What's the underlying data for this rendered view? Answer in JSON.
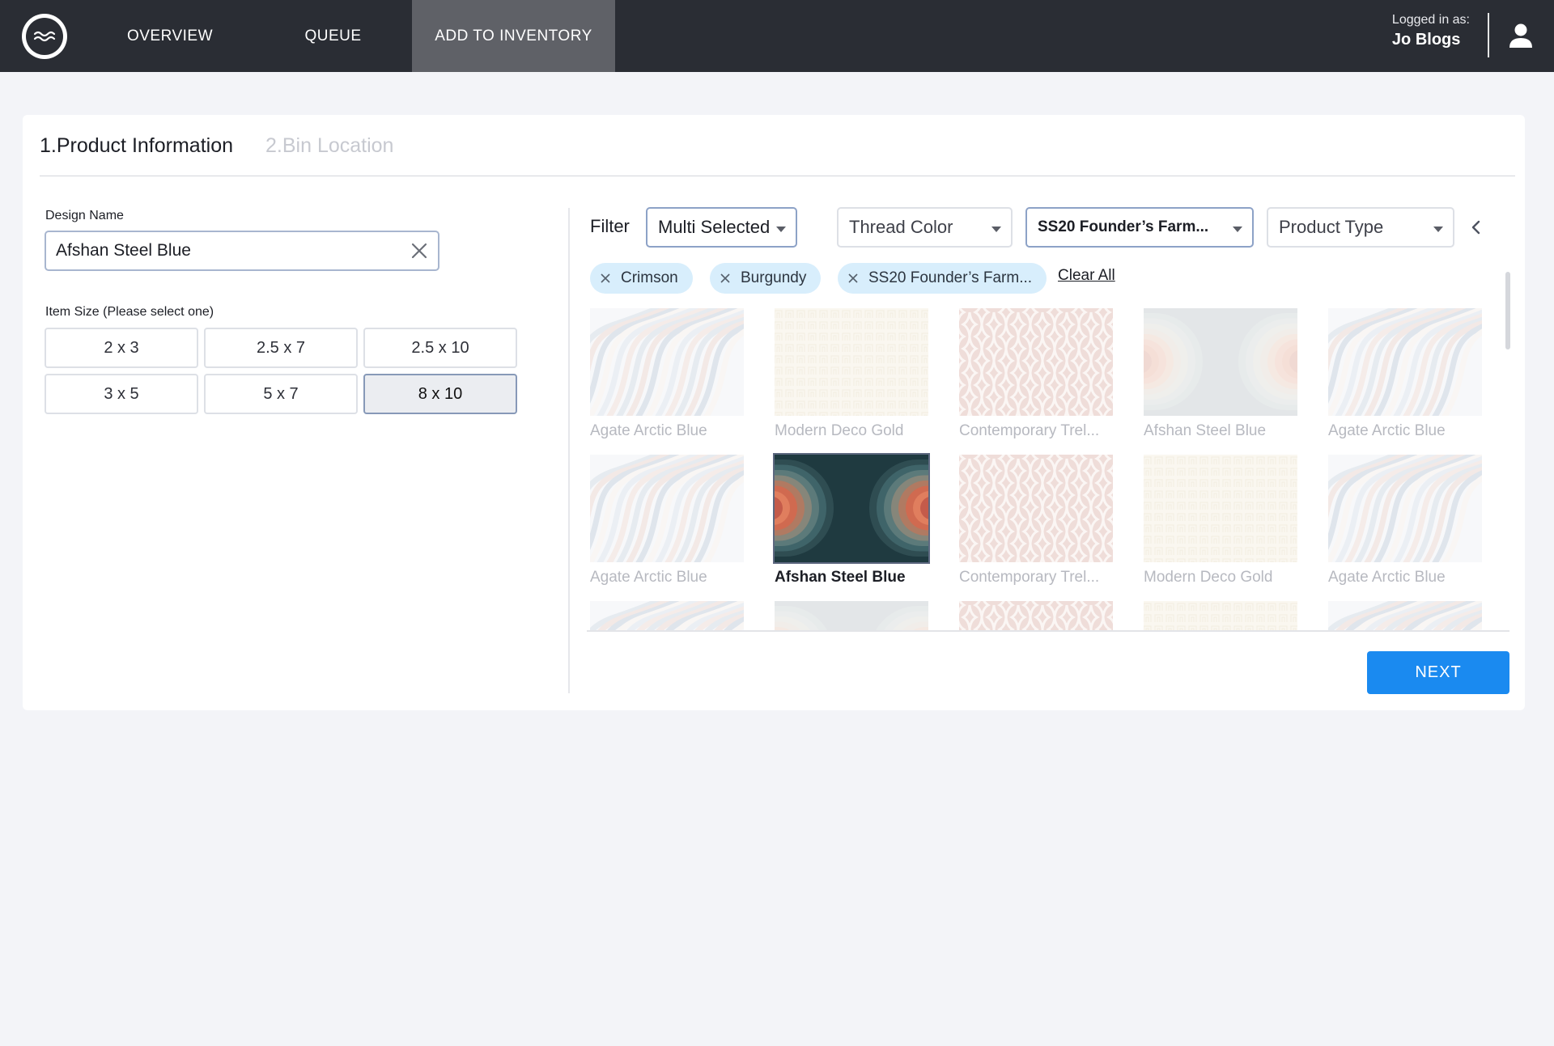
{
  "nav": {
    "tabs": [
      {
        "label": "OVERVIEW",
        "active": false
      },
      {
        "label": "QUEUE",
        "active": false
      },
      {
        "label": "ADD TO INVENTORY",
        "active": true
      }
    ],
    "user_caption": "Logged in as:",
    "user_name": "Jo Blogs",
    "logo_icon": "wave-logo-icon",
    "user_icon": "person-icon"
  },
  "steps": {
    "step1": "1.Product Information",
    "step2": "2.Bin Location"
  },
  "form": {
    "design_name_label": "Design Name",
    "design_name_value": "Afshan Steel Blue",
    "item_size_label": "Item Size (Please select one)",
    "sizes": [
      {
        "label": "2 x 3",
        "selected": false
      },
      {
        "label": "2.5 x 7",
        "selected": false
      },
      {
        "label": "2.5 x 10",
        "selected": false
      },
      {
        "label": "3 x 5",
        "selected": false
      },
      {
        "label": "5 x 7",
        "selected": false
      },
      {
        "label": "8 x 10",
        "selected": true
      }
    ]
  },
  "filters": {
    "label": "Filter",
    "selects": [
      {
        "value": "Multi Selected"
      },
      {
        "value": "Thread Color"
      },
      {
        "value": "SS20 Founder’s Farm..."
      },
      {
        "value": "Product Type"
      }
    ],
    "chips": [
      {
        "label": "Crimson"
      },
      {
        "label": "Burgundy"
      },
      {
        "label": "SS20 Founder’s Farm..."
      }
    ],
    "clear_all": "Clear All"
  },
  "gallery": {
    "tiles": [
      {
        "name": "Agate Arctic Blue",
        "pattern": "agate",
        "selected": false
      },
      {
        "name": "Modern Deco Gold",
        "pattern": "deco",
        "selected": false
      },
      {
        "name": "Contemporary Trel...",
        "pattern": "trellis",
        "selected": false
      },
      {
        "name": "Afshan Steel Blue",
        "pattern": "afshan",
        "selected": false
      },
      {
        "name": "Agate Arctic Blue",
        "pattern": "agate",
        "selected": false
      },
      {
        "name": "Agate Arctic Blue",
        "pattern": "agate",
        "selected": false
      },
      {
        "name": "Afshan Steel Blue",
        "pattern": "afshan",
        "selected": true
      },
      {
        "name": "Contemporary Trel...",
        "pattern": "trellis",
        "selected": false
      },
      {
        "name": "Modern Deco Gold",
        "pattern": "deco",
        "selected": false
      },
      {
        "name": "Agate Arctic Blue",
        "pattern": "agate",
        "selected": false
      },
      {
        "name": "",
        "pattern": "agate",
        "selected": false
      },
      {
        "name": "",
        "pattern": "afshan",
        "selected": false
      },
      {
        "name": "",
        "pattern": "trellis",
        "selected": false
      },
      {
        "name": "",
        "pattern": "deco",
        "selected": false
      },
      {
        "name": "",
        "pattern": "agate",
        "selected": false
      }
    ]
  },
  "actions": {
    "next_label": "NEXT"
  },
  "colors": {
    "nav_bg": "#2a2d34",
    "nav_active": "#5f6167",
    "primary": "#1a8af0",
    "chip_bg": "#d8eefc"
  }
}
